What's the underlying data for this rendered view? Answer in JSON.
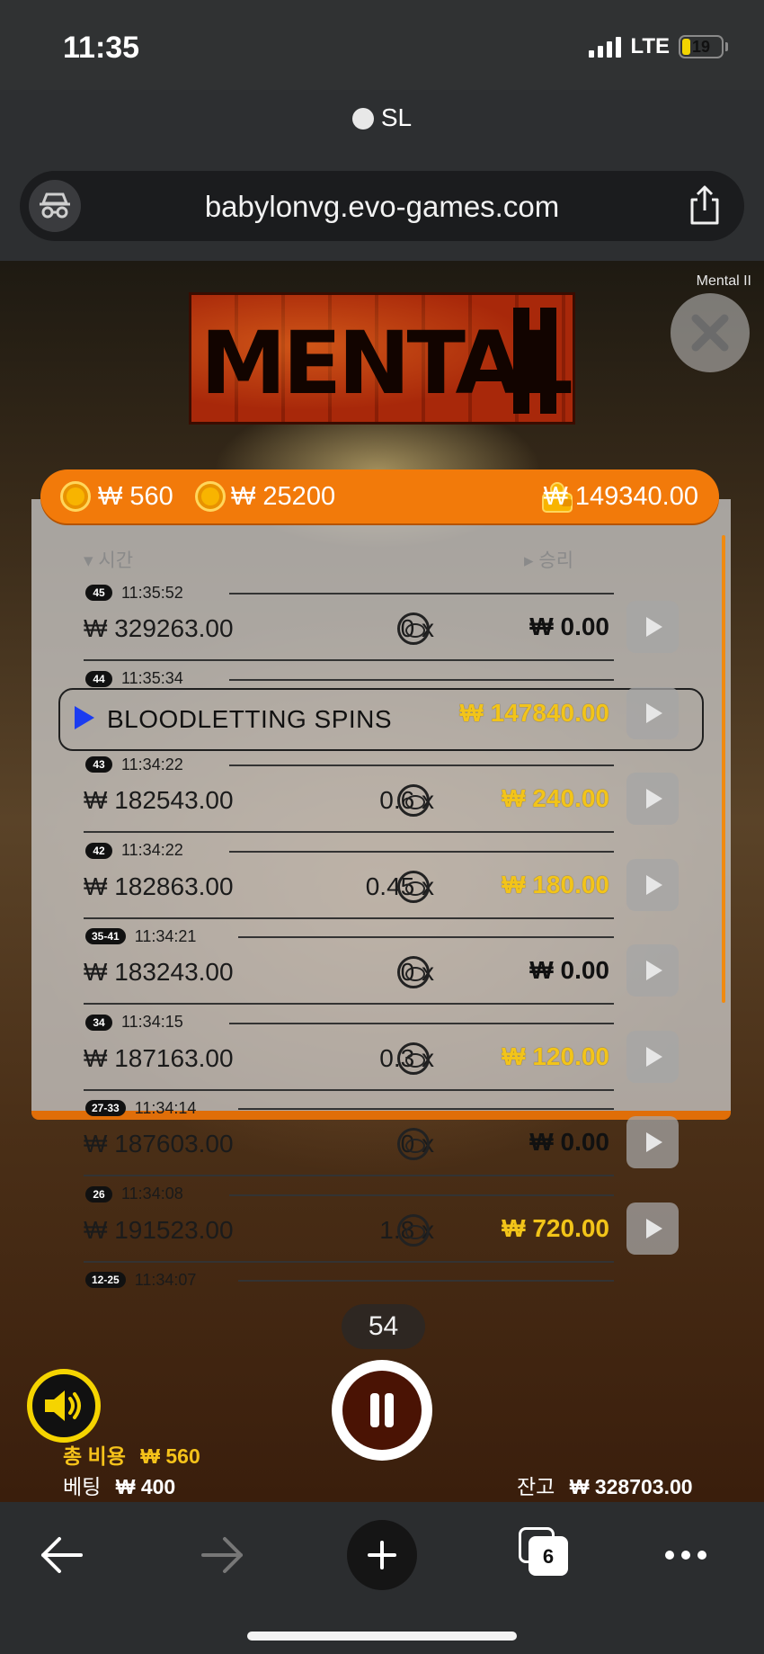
{
  "status_bar": {
    "time": "11:35",
    "network": "LTE",
    "battery": "19",
    "battery_level": 0.19
  },
  "browser": {
    "site_label": "SL",
    "url": "babylonvg.evo-games.com",
    "tabs_count": "6"
  },
  "game": {
    "name_label": "Mental II",
    "logo_text": "MENTAL",
    "bar": {
      "bet_value": "₩ 560",
      "coin_value": "₩ 25200",
      "balance_value": "₩ 149340.00"
    },
    "history": {
      "col_time": "시간",
      "col_win": "승리",
      "rows": [
        {
          "badge": "45",
          "time": "11:35:52",
          "bet": "₩ 329263.00",
          "mult": "0 x",
          "win": "₩ 0.00",
          "gold": false
        },
        {
          "badge": "44",
          "time": "11:35:34",
          "feature": "BLOODLETTING SPINS",
          "win": "₩ 147840.00",
          "gold": true
        },
        {
          "badge": "43",
          "time": "11:34:22",
          "bet": "₩ 182543.00",
          "mult": "0.6 x",
          "win": "₩ 240.00",
          "gold": true
        },
        {
          "badge": "42",
          "time": "11:34:22",
          "bet": "₩ 182863.00",
          "mult": "0.45 x",
          "win": "₩ 180.00",
          "gold": true
        },
        {
          "badge": "35-41",
          "time": "11:34:21",
          "bet": "₩ 183243.00",
          "mult": "0 x",
          "win": "₩ 0.00",
          "gold": false
        },
        {
          "badge": "34",
          "time": "11:34:15",
          "bet": "₩ 187163.00",
          "mult": "0.3 x",
          "win": "₩ 120.00",
          "gold": true
        },
        {
          "badge": "27-33",
          "time": "11:34:14",
          "bet": "₩ 187603.00",
          "mult": "0 x",
          "win": "₩ 0.00",
          "gold": false
        },
        {
          "badge": "26",
          "time": "11:34:08",
          "bet": "₩ 191523.00",
          "mult": "1.8 x",
          "win": "₩ 720.00",
          "gold": true
        },
        {
          "badge": "12-25",
          "time": "11:34:07"
        }
      ]
    },
    "round_counter": "54",
    "total_cost_label": "총 비용",
    "total_cost_value": "₩ 560",
    "bet_label": "베팅",
    "bet_value": "₩ 400",
    "balance_label": "잔고",
    "balance_value": "₩ 328703.00"
  },
  "colors": {
    "accent_orange": "#f27a0a",
    "gold_win": "#f2c41a",
    "feature_arrow": "#1b3cf0"
  }
}
